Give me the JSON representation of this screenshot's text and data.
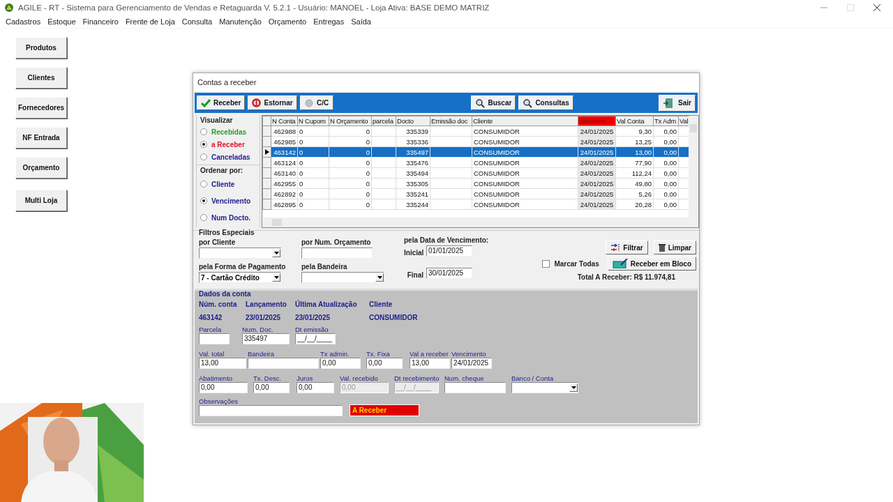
{
  "window": {
    "title": "AGILE - RT - Sistema para Gerenciamento de Vendas e Retaguarda  V. 5.2.1 - Usuário: MANOEL - Loja Ativa: BASE DEMO MATRIZ"
  },
  "menu": [
    "Cadastros",
    "Estoque",
    "Financeiro",
    "Frente de Loja",
    "Consulta",
    "Manutenção",
    "Orçamento",
    "Entregas",
    "Saída"
  ],
  "side_buttons": [
    "Produtos",
    "Clientes",
    "Fornecedores",
    "NF Entrada",
    "Orçamento",
    "Multi Loja"
  ],
  "dialog": {
    "title": "Contas a receber",
    "toolbar_left": [
      {
        "label": "Receber",
        "kind": "confirm"
      },
      {
        "label": "Estornar",
        "kind": "reverse"
      },
      {
        "label": "C/C",
        "kind": "account"
      }
    ],
    "toolbar_right": [
      {
        "label": "Buscar",
        "kind": "search"
      },
      {
        "label": "Consultas",
        "kind": "search"
      }
    ],
    "exit_button": {
      "label": "Sair",
      "kind": "exit"
    },
    "visualizar": {
      "title": "Visualizar",
      "options": [
        {
          "label": "Recebidas",
          "selected": false,
          "color": "#2e9a2e"
        },
        {
          "label": "a Receber",
          "selected": true,
          "color": "#e0102a"
        },
        {
          "label": "Canceladas",
          "selected": false,
          "color": "#1c1c9c"
        }
      ]
    },
    "ordenar": {
      "title": "Ordenar por:",
      "options": [
        {
          "label": "Cliente",
          "selected": false
        },
        {
          "label": "Vencimento",
          "selected": true
        },
        {
          "label": "Num Docto.",
          "selected": false
        }
      ]
    },
    "table": {
      "columns": [
        {
          "label": "N Conta",
          "highlighted": false
        },
        {
          "label": "N Cupom",
          "highlighted": false
        },
        {
          "label": "N Orçamento",
          "highlighted": false
        },
        {
          "label": "parcela",
          "highlighted": false
        },
        {
          "label": "Docto",
          "highlighted": false
        },
        {
          "label": "Emissão doc",
          "highlighted": false
        },
        {
          "label": "Cliente",
          "highlighted": false
        },
        {
          "label": "dataVenc.",
          "highlighted": true
        },
        {
          "label": "Val Conta",
          "highlighted": false
        },
        {
          "label": "Tx Adm",
          "highlighted": false
        },
        {
          "label": "Val",
          "highlighted": false
        }
      ],
      "rows": [
        {
          "n_conta": "462988",
          "n_cupom": "0",
          "n_orcamento": "0",
          "docto": "335339",
          "cliente": "CONSUMIDOR",
          "vencimento": "24/01/2025",
          "val_conta": "9,30",
          "tx_adm": "0,00",
          "selected": false
        },
        {
          "n_conta": "462985",
          "n_cupom": "0",
          "n_orcamento": "0",
          "docto": "335336",
          "cliente": "CONSUMIDOR",
          "vencimento": "24/01/2025",
          "val_conta": "13,25",
          "tx_adm": "0,00",
          "selected": false
        },
        {
          "n_conta": "463142",
          "n_cupom": "0",
          "n_orcamento": "0",
          "docto": "335497",
          "cliente": "CONSUMIDOR",
          "vencimento": "24/01/2025",
          "val_conta": "13,00",
          "tx_adm": "0,00",
          "selected": true
        },
        {
          "n_conta": "463124",
          "n_cupom": "0",
          "n_orcamento": "0",
          "docto": "335476",
          "cliente": "CONSUMIDOR",
          "vencimento": "24/01/2025",
          "val_conta": "77,90",
          "tx_adm": "0,00",
          "selected": false
        },
        {
          "n_conta": "463140",
          "n_cupom": "0",
          "n_orcamento": "0",
          "docto": "335494",
          "cliente": "CONSUMIDOR",
          "vencimento": "24/01/2025",
          "val_conta": "112,24",
          "tx_adm": "0,00",
          "selected": false
        },
        {
          "n_conta": "462955",
          "n_cupom": "0",
          "n_orcamento": "0",
          "docto": "335305",
          "cliente": "CONSUMIDOR",
          "vencimento": "24/01/2025",
          "val_conta": "49,80",
          "tx_adm": "0,00",
          "selected": false
        },
        {
          "n_conta": "462892",
          "n_cupom": "0",
          "n_orcamento": "0",
          "docto": "335241",
          "cliente": "CONSUMIDOR",
          "vencimento": "24/01/2025",
          "val_conta": "5,26",
          "tx_adm": "0,00",
          "selected": false
        },
        {
          "n_conta": "462895",
          "n_cupom": "0",
          "n_orcamento": "0",
          "docto": "335244",
          "cliente": "CONSUMIDOR",
          "vencimento": "24/01/2025",
          "val_conta": "20,28",
          "tx_adm": "0,00",
          "selected": false
        }
      ]
    },
    "filters": {
      "title": "Filtros Especiais",
      "por_cliente": "por Cliente",
      "por_num_orcamento": "por Num. Orçamento",
      "forma_pagamento": {
        "label": "pela Forma de Pagamento",
        "value": "7 - Cartão Crédito"
      },
      "bandeira": "pela Bandeira",
      "vencimento": {
        "label": "pela Data de Vencimento:",
        "inicial_label": "Inicial",
        "inicial": "01/01/2025",
        "final_label": "Final",
        "final": "30/01/2025"
      },
      "marcar_todas": {
        "label": "Marcar Todas",
        "checked": false
      },
      "filtrar": "Filtrar",
      "limpar": "Limpar",
      "receber_bloco": "Receber em Bloco",
      "total": "Total A Receber: R$ 11.974,81"
    },
    "dados": {
      "title": "Dados da conta",
      "headers": [
        "Núm. conta",
        "Lançamento",
        "Última Atualização",
        "Cliente"
      ],
      "values": [
        "463142",
        "23/01/2025",
        "23/01/2025",
        "CONSUMIDOR"
      ],
      "field_rows": [
        [
          {
            "label": "Parcela",
            "kind": "text",
            "disabled": false
          },
          {
            "label": "Num. Doc.",
            "value": "335497",
            "kind": "text",
            "disabled": false
          },
          {
            "label": "Dt emissão",
            "value": "__/__/____",
            "kind": "text",
            "disabled": false
          }
        ],
        [
          {
            "label": "Val. total",
            "value": "13,00",
            "kind": "text",
            "disabled": false
          },
          {
            "label": "Bandeira",
            "kind": "text",
            "disabled": false
          },
          {
            "label": "Tx admin.",
            "value": "0,00",
            "kind": "text",
            "disabled": false
          },
          {
            "label": "Tx. Fixa",
            "value": "0,00",
            "kind": "text",
            "disabled": false
          },
          {
            "label": "Val a receber",
            "value": "13,00",
            "kind": "text",
            "disabled": false
          },
          {
            "label": "Vencimento",
            "value": "24/01/2025",
            "kind": "text",
            "disabled": false
          }
        ],
        [
          {
            "label": "Abatimento",
            "value": "0,00",
            "kind": "text",
            "disabled": false
          },
          {
            "label": "Tx. Desc.",
            "value": "0,00",
            "kind": "text",
            "disabled": false
          },
          {
            "label": "Juros",
            "value": "0,00",
            "kind": "text",
            "disabled": false
          },
          {
            "label": "Val. recebido",
            "value": "0,00",
            "kind": "text",
            "disabled": true
          },
          {
            "label": "Dt recebimento",
            "value": "__/__/____",
            "kind": "text",
            "disabled": true
          },
          {
            "label": "Num. cheque",
            "kind": "text",
            "disabled": false
          },
          {
            "label": "Banco / Conta",
            "kind": "select",
            "disabled": false
          }
        ]
      ],
      "observacoes": "Observações",
      "status": "A Receber"
    }
  },
  "webcam": {
    "kind": "picture"
  }
}
